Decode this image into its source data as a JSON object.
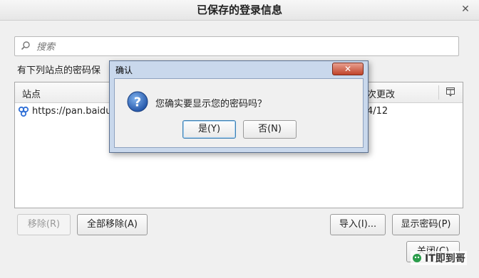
{
  "window": {
    "title": "已保存的登录信息",
    "close_glyph": "✕"
  },
  "search": {
    "placeholder": "搜索",
    "value": ""
  },
  "description": "有下列站点的密码保",
  "table": {
    "headers": {
      "site": "站点",
      "changed": "次更改"
    },
    "rows": [
      {
        "site": "https://pan.baidu.c",
        "date": "4/12",
        "icon": "baidu-icon"
      }
    ]
  },
  "buttons": {
    "remove": "移除(R)",
    "remove_all": "全部移除(A)",
    "import": "导入(I)...",
    "show_passwords": "显示密码(P)",
    "close": "关闭(C)"
  },
  "watermark": "IT即到哥",
  "dialog": {
    "title": "确认",
    "close_glyph": "✕",
    "message": "您确实要显示您的密码吗？",
    "yes": "是(Y)",
    "no": "否(N)"
  },
  "colors": {
    "question_icon": "#2a62b8",
    "dialog_frame": "#c9d8ec",
    "close_button": "#c0432a"
  }
}
